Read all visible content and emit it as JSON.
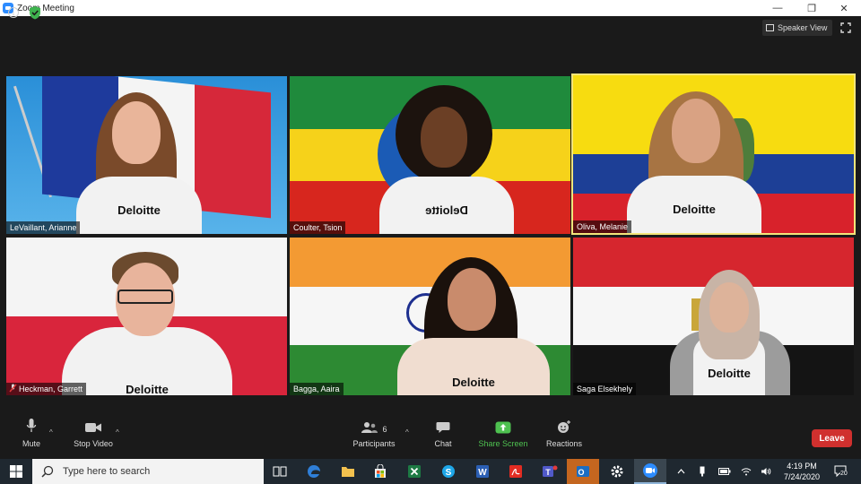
{
  "window": {
    "title": "Zoom Meeting",
    "minimize": "—",
    "restore": "❐",
    "close": "✕"
  },
  "topbar": {
    "info_glyph": "i",
    "speaker_view_label": "Speaker View"
  },
  "participants": [
    {
      "name": "LeVaillant, Arianne",
      "flag": "france",
      "shirt_logo": "Deloitte"
    },
    {
      "name": "Coulter, Tsion",
      "flag": "ethiopia",
      "shirt_logo": "Deloitte",
      "mirrored": true
    },
    {
      "name": "Oliva, Melanie",
      "flag": "ecuador",
      "shirt_logo": "Deloitte",
      "active_speaker": true
    },
    {
      "name": "Heckman, Garrett",
      "flag": "poland",
      "shirt_logo": "Deloitte",
      "muted": true
    },
    {
      "name": "Bagga, Aaira",
      "flag": "india",
      "shirt_logo": "Deloitte"
    },
    {
      "name": "Saga Elsekhely",
      "flag": "egypt",
      "shirt_logo": "Deloitte"
    }
  ],
  "controls": {
    "mute_label": "Mute",
    "stop_video_label": "Stop Video",
    "participants_label": "Participants",
    "participants_count": "6",
    "chat_label": "Chat",
    "share_screen_label": "Share Screen",
    "reactions_label": "Reactions",
    "leave_label": "Leave",
    "caret": "^"
  },
  "taskbar": {
    "search_placeholder": "Type here to search",
    "apps": [
      "task-view",
      "edge",
      "file-explorer",
      "store",
      "excel",
      "skype",
      "word",
      "acrobat",
      "teams",
      "outlook",
      "settings",
      "zoom"
    ],
    "clock_time": "4:19 PM",
    "clock_date": "7/24/2020",
    "notification_count": "20"
  },
  "colors": {
    "accent_green": "#4ec150",
    "leave_red": "#d0302e",
    "active_border": "#f3e57a",
    "zoom_blue": "#2d8cff"
  }
}
